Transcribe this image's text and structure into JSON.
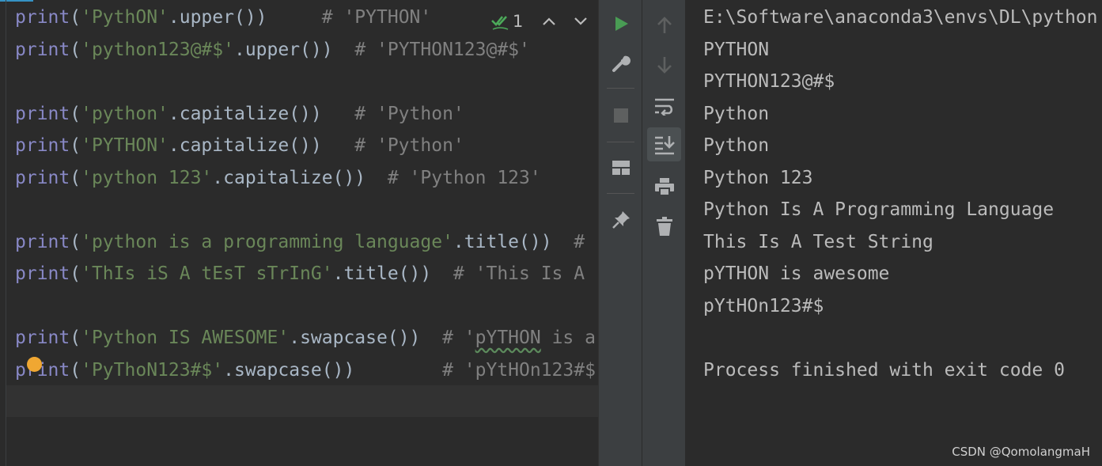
{
  "editor": {
    "inspections": {
      "count": "1"
    },
    "lines": [
      {
        "tokens": [
          {
            "t": "fn",
            "v": "print"
          },
          {
            "t": "plain",
            "v": "("
          },
          {
            "t": "str",
            "v": "'PythON'"
          },
          {
            "t": "plain",
            "v": ".upper())     "
          },
          {
            "t": "com",
            "v": "# 'PYTHON'"
          }
        ]
      },
      {
        "tokens": [
          {
            "t": "fn",
            "v": "print"
          },
          {
            "t": "plain",
            "v": "("
          },
          {
            "t": "str",
            "v": "'python123@#$'"
          },
          {
            "t": "plain",
            "v": ".upper())  "
          },
          {
            "t": "com",
            "v": "# 'PYTHON123@#$'"
          }
        ]
      },
      {
        "tokens": []
      },
      {
        "tokens": [
          {
            "t": "fn",
            "v": "print"
          },
          {
            "t": "plain",
            "v": "("
          },
          {
            "t": "str",
            "v": "'python'"
          },
          {
            "t": "plain",
            "v": ".capitalize())   "
          },
          {
            "t": "com",
            "v": "# 'Python'"
          }
        ]
      },
      {
        "tokens": [
          {
            "t": "fn",
            "v": "print"
          },
          {
            "t": "plain",
            "v": "("
          },
          {
            "t": "str",
            "v": "'PYTHON'"
          },
          {
            "t": "plain",
            "v": ".capitalize())   "
          },
          {
            "t": "com",
            "v": "# 'Python'"
          }
        ]
      },
      {
        "tokens": [
          {
            "t": "fn",
            "v": "print"
          },
          {
            "t": "plain",
            "v": "("
          },
          {
            "t": "str",
            "v": "'python 123'"
          },
          {
            "t": "plain",
            "v": ".capitalize())  "
          },
          {
            "t": "com",
            "v": "# 'Python 123'"
          }
        ]
      },
      {
        "tokens": []
      },
      {
        "tokens": [
          {
            "t": "fn",
            "v": "print"
          },
          {
            "t": "plain",
            "v": "("
          },
          {
            "t": "str",
            "v": "'python is a programming language'"
          },
          {
            "t": "plain",
            "v": ".title())  "
          },
          {
            "t": "com",
            "v": "#"
          }
        ]
      },
      {
        "tokens": [
          {
            "t": "fn",
            "v": "print"
          },
          {
            "t": "plain",
            "v": "("
          },
          {
            "t": "str",
            "v": "'ThIs iS A tEsT sTrInG'"
          },
          {
            "t": "plain",
            "v": ".title())  "
          },
          {
            "t": "com",
            "v": "# 'This Is A"
          }
        ]
      },
      {
        "tokens": []
      },
      {
        "tokens": [
          {
            "t": "fn",
            "v": "print"
          },
          {
            "t": "plain",
            "v": "("
          },
          {
            "t": "str",
            "v": "'Python IS AWESOME'"
          },
          {
            "t": "plain",
            "v": ".swapcase())  "
          },
          {
            "t": "com",
            "v": "# '"
          },
          {
            "t": "comsq",
            "v": "pYTHON"
          },
          {
            "t": "com",
            "v": " is a"
          }
        ]
      },
      {
        "tokens": [
          {
            "t": "fn",
            "v": "print"
          },
          {
            "t": "plain",
            "v": "("
          },
          {
            "t": "str",
            "v": "'PyThoN123#$'"
          },
          {
            "t": "plain",
            "v": ".swapcase())        "
          },
          {
            "t": "com",
            "v": "# 'pYtHOn123#$"
          }
        ]
      }
    ]
  },
  "toolbar": {
    "left": [
      {
        "name": "rerun-button",
        "icon": "play-icon"
      },
      {
        "name": "settings-button",
        "icon": "wrench-icon"
      },
      {
        "name": "stop-button",
        "icon": "stop-icon"
      },
      {
        "name": "layout-button",
        "icon": "layout-icon"
      },
      {
        "name": "pin-button",
        "icon": "pin-icon"
      }
    ],
    "right": [
      {
        "name": "up-button",
        "icon": "arrow-up-icon"
      },
      {
        "name": "down-button",
        "icon": "arrow-down-icon"
      },
      {
        "name": "soft-wrap-button",
        "icon": "soft-wrap-icon"
      },
      {
        "name": "scroll-to-end-button",
        "icon": "scroll-end-icon"
      },
      {
        "name": "print-button",
        "icon": "print-icon"
      },
      {
        "name": "clear-button",
        "icon": "trash-icon"
      }
    ],
    "colors": {
      "play": "#499c54",
      "icon": "#afb1b3",
      "disabled": "#5e6060"
    }
  },
  "console": {
    "lines": [
      "E:\\Software\\anaconda3\\envs\\DL\\python",
      "PYTHON",
      "PYTHON123@#$",
      "Python",
      "Python",
      "Python 123",
      "Python Is A Programming Language",
      "This Is A Test String",
      "pYTHON is awesome",
      "pYtHOn123#$",
      "",
      "Process finished with exit code 0"
    ],
    "watermark": "CSDN @QomolangmaH"
  }
}
